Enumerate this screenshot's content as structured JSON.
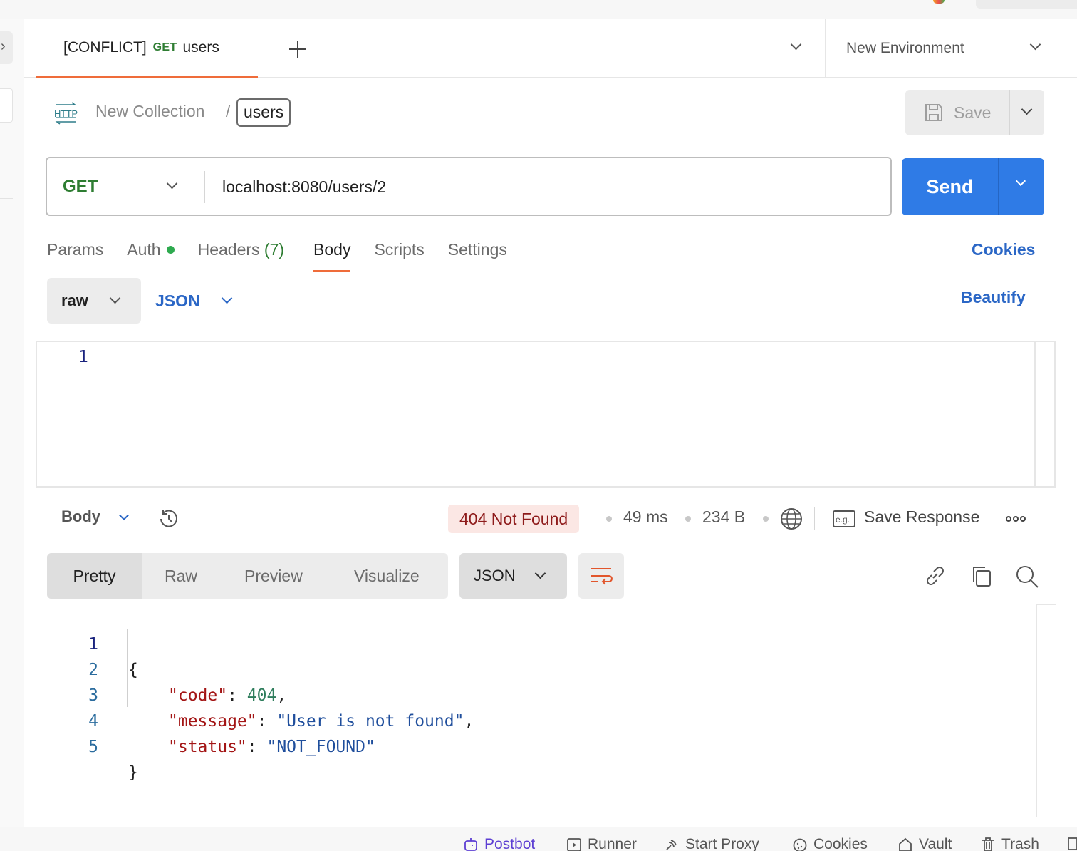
{
  "tab": {
    "conflict_tag": "[CONFLICT]",
    "method": "GET",
    "name": "users"
  },
  "environment": {
    "selected": "New Environment"
  },
  "breadcrumb": {
    "collection": "New Collection",
    "separator": "/",
    "request": "users"
  },
  "toolbar": {
    "save_label": "Save"
  },
  "request": {
    "method": "GET",
    "url": "localhost:8080/users/2",
    "send_label": "Send"
  },
  "request_tabs": {
    "params": "Params",
    "auth": "Auth",
    "headers": "Headers",
    "headers_count": "(7)",
    "body": "Body",
    "scripts": "Scripts",
    "settings": "Settings",
    "active": "Body"
  },
  "cookies_label": "Cookies",
  "body_options": {
    "mode": "raw",
    "language": "JSON",
    "beautify_label": "Beautify"
  },
  "request_editor": {
    "line_numbers": [
      "1"
    ]
  },
  "response": {
    "section_label": "Body",
    "status": "404 Not Found",
    "status_color": "#8e1b1b",
    "time": "49 ms",
    "size": "234 B",
    "save_response_label": "Save Response",
    "view_tabs": [
      "Pretty",
      "Raw",
      "Preview",
      "Visualize"
    ],
    "active_view": "Pretty",
    "format": "JSON",
    "lines": [
      {
        "num": "1",
        "text": "{"
      },
      {
        "num": "2",
        "key": "\"code\"",
        "colon": ": ",
        "value": "404",
        "trail": ","
      },
      {
        "num": "3",
        "key": "\"message\"",
        "colon": ": ",
        "value": "\"User is not found\"",
        "trail": ","
      },
      {
        "num": "4",
        "key": "\"status\"",
        "colon": ": ",
        "value": "\"NOT_FOUND\"",
        "trail": ""
      },
      {
        "num": "5",
        "text": "}"
      }
    ]
  },
  "statusbar": {
    "postbot": "Postbot",
    "runner": "Runner",
    "start_proxy": "Start Proxy",
    "cookies": "Cookies",
    "vault": "Vault",
    "trash": "Trash"
  },
  "colors": {
    "accent": "#2f7be6",
    "link": "#2b67c6",
    "active_tab_underline": "#ef6c3a",
    "method_get": "#2e7d32"
  }
}
